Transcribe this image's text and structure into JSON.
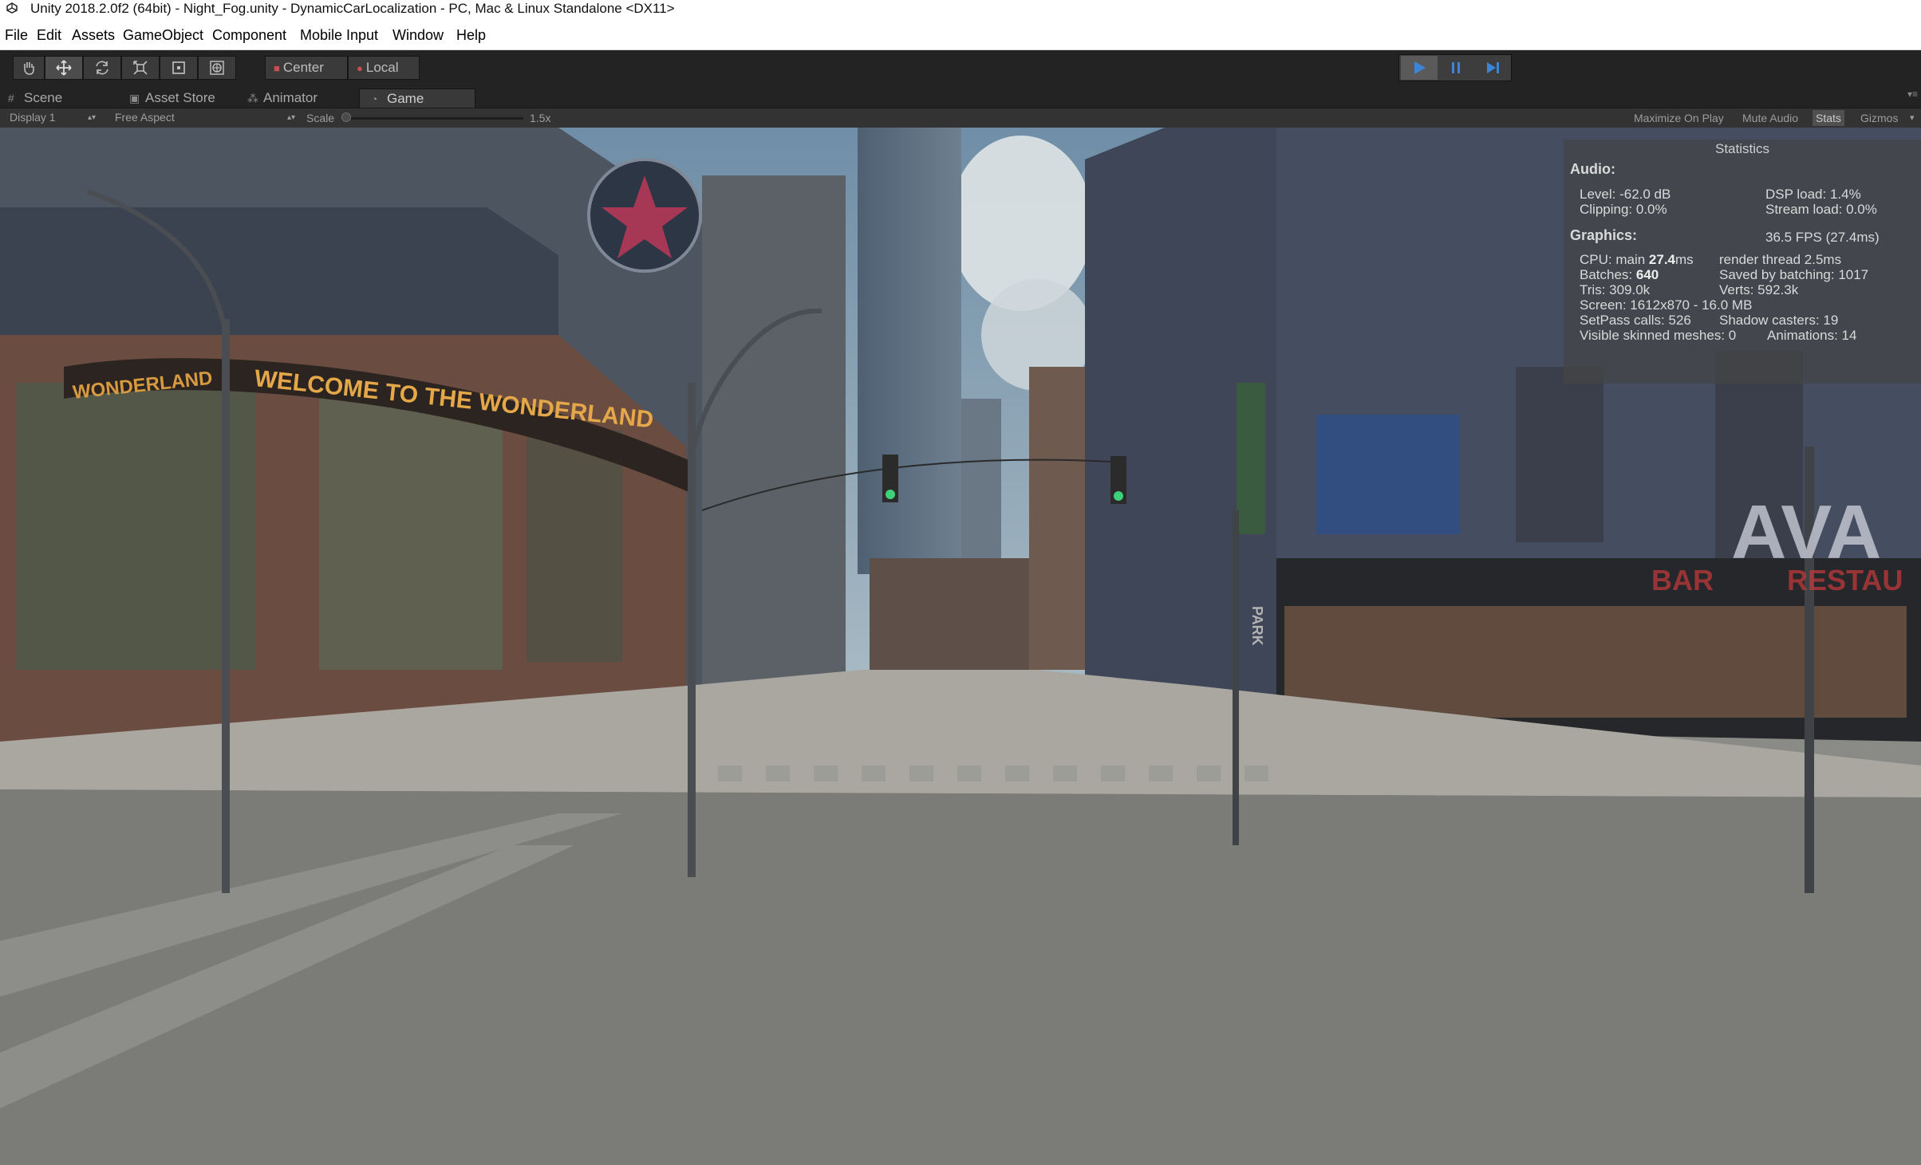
{
  "window": {
    "title": "Unity 2018.2.0f2 (64bit) - Night_Fog.unity - DynamicCarLocalization - PC, Mac & Linux Standalone <DX11>"
  },
  "menu": {
    "items": [
      "File",
      "Edit",
      "Assets",
      "GameObject",
      "Component",
      "Mobile Input",
      "Window",
      "Help"
    ]
  },
  "toolbar": {
    "tools": [
      "hand-tool",
      "move-tool",
      "rotate-tool",
      "scale-tool",
      "rect-tool",
      "transform-tool"
    ],
    "active_tool": "move-tool",
    "pivot": {
      "center": "Center",
      "local": "Local"
    },
    "playback": {
      "play": "play",
      "pause": "pause",
      "step": "step",
      "playing": true
    },
    "accent": "#3c84d8"
  },
  "tabs": [
    {
      "label": "Scene",
      "icon": "grid-icon"
    },
    {
      "label": "Asset Store",
      "icon": "bag-icon"
    },
    {
      "label": "Animator",
      "icon": "animator-icon"
    },
    {
      "label": "Game",
      "icon": "pacman-icon",
      "active": true
    }
  ],
  "game_controls": {
    "display": "Display 1",
    "aspect": "Free Aspect",
    "scale_label": "Scale",
    "scale_value": "1.5x",
    "scale_fraction": 0.0,
    "maximize": "Maximize On Play",
    "mute": "Mute Audio",
    "stats": "Stats",
    "stats_on": true,
    "gizmos": "Gizmos"
  },
  "statistics": {
    "title": "Statistics",
    "audio_header": "Audio:",
    "level": "Level: -62.0 dB",
    "clipping": "Clipping: 0.0%",
    "dsp": "DSP load: 1.4%",
    "stream": "Stream load: 0.0%",
    "graphics_header": "Graphics:",
    "fps": "36.5 FPS (27.4ms)",
    "cpu_label": "CPU: main ",
    "cpu_value": "27.4",
    "cpu_unit": "ms",
    "render_thread": "render thread 2.5ms",
    "batches_label": "Batches: ",
    "batches_value": "640",
    "saved_batching": "Saved by batching: 1017",
    "tris": "Tris: 309.0k",
    "verts": "Verts: 592.3k",
    "screen": "Screen: 1612x870 - 16.0 MB",
    "setpass": "SetPass calls: 526",
    "shadow_casters": "Shadow casters: 19",
    "visible_skinned": "Visible skinned meshes: 0",
    "animations": "Animations: 14"
  },
  "scene_signs": {
    "marquee": "WELCOME TO THE WONDERLAND",
    "marquee_left": "WONDERLAND",
    "bar": "BAR",
    "restaurant": "RESTAU",
    "ava": "AVA",
    "park": "PARK"
  }
}
